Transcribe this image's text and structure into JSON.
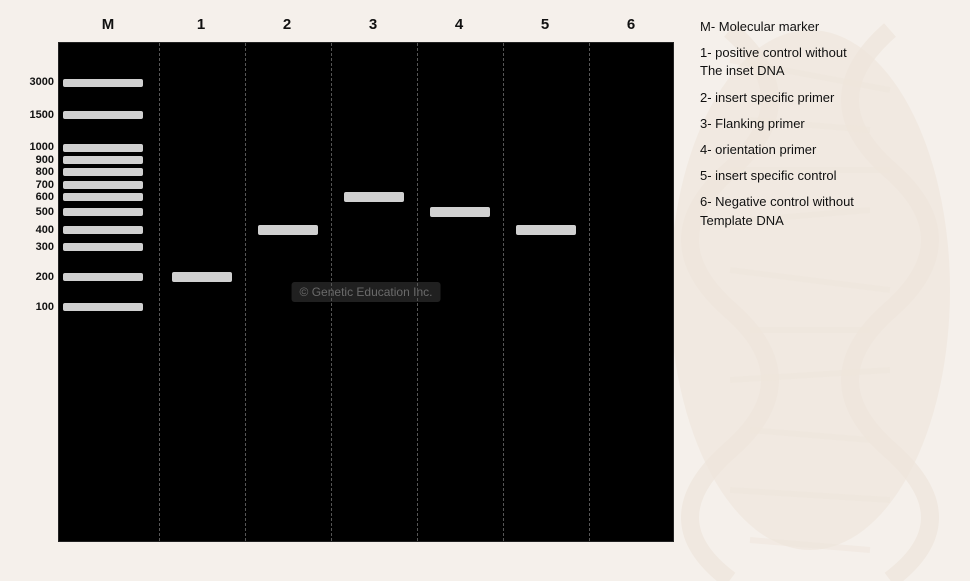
{
  "gel": {
    "watermark": "© Genetic Education Inc.",
    "lanes": {
      "headers": [
        "M",
        "1",
        "2",
        "3",
        "4",
        "5",
        "6"
      ]
    },
    "markerLabels": [
      {
        "label": "3000",
        "topPct": 8
      },
      {
        "label": "1500",
        "topPct": 14.5
      },
      {
        "label": "1000",
        "topPct": 21
      },
      {
        "label": "900",
        "topPct": 23.5
      },
      {
        "label": "800",
        "topPct": 26
      },
      {
        "label": "700",
        "topPct": 28.5
      },
      {
        "label": "600",
        "topPct": 31
      },
      {
        "label": "500",
        "topPct": 34
      },
      {
        "label": "400",
        "topPct": 37.5
      },
      {
        "label": "300",
        "topPct": 41
      },
      {
        "label": "200",
        "topPct": 47
      },
      {
        "label": "100",
        "topPct": 53
      }
    ],
    "markerBands": [
      {
        "topPct": 8
      },
      {
        "topPct": 14.5
      },
      {
        "topPct": 21
      },
      {
        "topPct": 23.5
      },
      {
        "topPct": 26
      },
      {
        "topPct": 28.5
      },
      {
        "topPct": 31
      },
      {
        "topPct": 34
      },
      {
        "topPct": 37.5
      },
      {
        "topPct": 41
      },
      {
        "topPct": 47
      },
      {
        "topPct": 53
      }
    ]
  },
  "legend": {
    "items": [
      {
        "label": "M- Molecular marker"
      },
      {
        "label": "1- positive control without\nThe inset DNA"
      },
      {
        "label": "2- insert specific primer"
      },
      {
        "label": "3- Flanking primer"
      },
      {
        "label": "4- orientation primer"
      },
      {
        "label": "5- insert specific control"
      },
      {
        "label": "6- Negative control without\nTemplate DNA"
      }
    ]
  }
}
